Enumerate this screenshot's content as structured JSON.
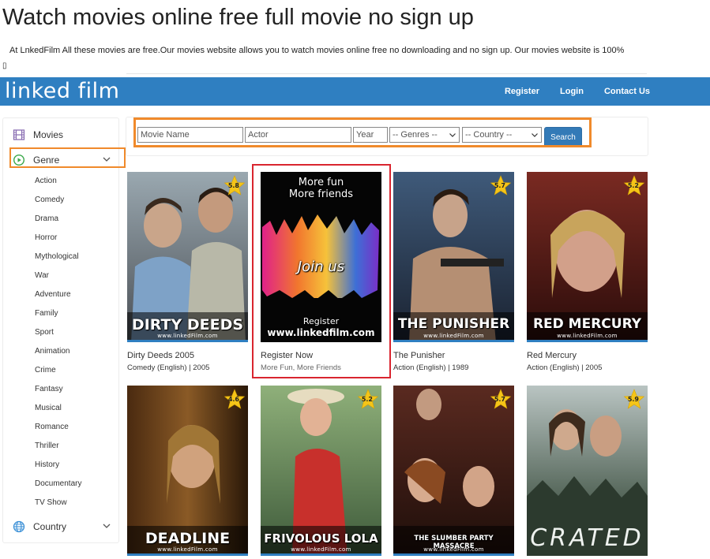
{
  "page": {
    "heading": "Watch movies online free full movie no sign up",
    "intro": "At LnkedFilm All these movies are free.Our movies website allows you to watch movies online free no downloading and no sign up. Our movies website is 100%",
    "intro_glyph": "▯"
  },
  "navbar": {
    "logo": "linked film",
    "links": [
      "Register",
      "Login",
      "Contact Us"
    ],
    "background": "#2f7fc1"
  },
  "sidebar": {
    "movies_label": "Movies",
    "genre_label": "Genre",
    "country_label": "Country",
    "genres": [
      "Action",
      "Comedy",
      "Drama",
      "Horror",
      "Mythological",
      "War",
      "Adventure",
      "Family",
      "Sport",
      "Animation",
      "Crime",
      "Fantasy",
      "Musical",
      "Romance",
      "Thriller",
      "History",
      "Documentary",
      "TV Show"
    ]
  },
  "search": {
    "movie_placeholder": "Movie Name",
    "actor_placeholder": "Actor",
    "year_placeholder": "Year",
    "genres_selected": "-- Genres --",
    "country_selected": "-- Country --",
    "button_label": "Search"
  },
  "watermark": "www.linkedFilm.com",
  "movies": [
    {
      "title": "Dirty Deeds 2005",
      "meta": "Comedy (English) | 2005",
      "rating": "5.8",
      "poster_text": "DIRTY DEEDS"
    },
    {
      "title": "Register Now",
      "meta": "More Fun, More Friends",
      "promo_top": "More fun",
      "promo_top2": "More friends",
      "promo_mid": "Join us",
      "promo_reg": "Register",
      "promo_url": "www.linkedfilm.com"
    },
    {
      "title": "The Punisher",
      "meta": "Action (English) | 1989",
      "rating": "5.7",
      "poster_text": "THE PUNISHER"
    },
    {
      "title": "Red Mercury",
      "meta": "Action (English) | 2005",
      "rating": "5.2",
      "poster_text": "RED MERCURY"
    },
    {
      "rating": "4.6",
      "poster_text": "DEADLINE"
    },
    {
      "rating": "5.2",
      "poster_text": "FRIVOLOUS LOLA"
    },
    {
      "rating": "5.7",
      "poster_text": "THE SLUMBER PARTY MASSACRE"
    },
    {
      "rating": "5.9",
      "poster_text": "CRATED"
    }
  ],
  "colors": {
    "accent_orange": "#f08a2b",
    "highlight_red": "#d9252f",
    "button_blue": "#337ab7",
    "star_yellow": "#f5c518"
  }
}
